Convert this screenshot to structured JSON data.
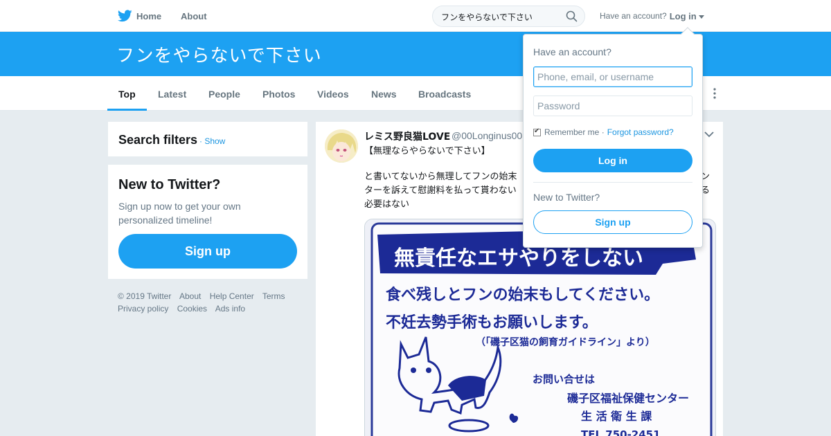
{
  "nav": {
    "home_label": "Home",
    "about_label": "About",
    "search_value": "フンをやらないで下さい",
    "account_prompt": "Have an account?",
    "login_label": "Log in"
  },
  "banner": {
    "title": "フンをやらないで下さい"
  },
  "tabs": [
    "Top",
    "Latest",
    "People",
    "Photos",
    "Videos",
    "News",
    "Broadcasts"
  ],
  "search_filters": {
    "title": "Search filters",
    "show_label": "· Show"
  },
  "new_to_twitter": {
    "title": "New to Twitter?",
    "description": "Sign up now to get your own personalized timeline!",
    "signup_label": "Sign up"
  },
  "footer": {
    "links": [
      "© 2019 Twitter",
      "About",
      "Help Center",
      "Terms",
      "Privacy policy",
      "Cookies",
      "Ads info"
    ]
  },
  "tweet": {
    "name": "レミス野良猫LOVE",
    "handle": "@00Longinus00",
    "line1": "【無理ならやらないで下さい】",
    "body_line1": "と書いてないから無理してフンの始末",
    "body_line2": "ターを訴えて慰謝料を払って貰わない",
    "body_line3": "必要はない",
    "body_right1": "ン",
    "body_right2": "る",
    "media_text": {
      "banner": "無責任なエサやりをしない",
      "line1": "食べ残しとフンの始末もしてください。",
      "line2": "不妊去勢手術もお願いします。",
      "line3": "（「磯子区猫の飼育ガイドライン」より）",
      "contact": "お問い合せは",
      "office1": "磯子区福祉保健センター",
      "office2": "生 活 衛 生 課",
      "tel": "TEL 750-2451"
    }
  },
  "login_dropdown": {
    "title": "Have an account?",
    "username_placeholder": "Phone, email, or username",
    "password_placeholder": "Password",
    "remember_label": "Remember me ·",
    "forgot_label": "Forgot password?",
    "login_button": "Log in",
    "new_prompt": "New to Twitter?",
    "signup_button": "Sign up"
  },
  "colors": {
    "brand_blue": "#1da1f2",
    "link_blue": "#1b95e0",
    "background": "#e6ecf0"
  },
  "icons": [
    "twitter-bird-icon",
    "search-icon",
    "chevron-down-icon",
    "more-vertical-icon"
  ]
}
